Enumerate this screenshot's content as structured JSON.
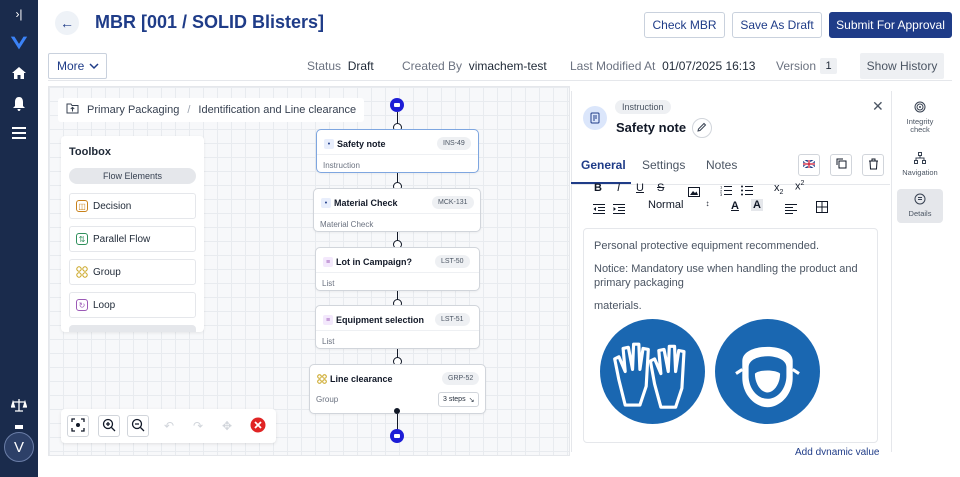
{
  "page": {
    "title": "MBR [001 / SOLID Blisters]"
  },
  "header": {
    "check_label": "Check MBR",
    "draft_label": "Save As Draft",
    "submit_label": "Submit For Approval",
    "more_label": "More",
    "status_label": "Status",
    "status_value": "Draft",
    "created_label": "Created By",
    "created_value": "vimachem-test",
    "modified_label": "Last Modified At",
    "modified_value": "01/07/2025 16:13",
    "version_label": "Version",
    "version_value": "1",
    "history_label": "Show History"
  },
  "breadcrumb": {
    "items": [
      "Primary Packaging",
      "Identification and Line clearance"
    ],
    "separator": "/"
  },
  "toolbox": {
    "title": "Toolbox",
    "section": "Flow Elements",
    "items": [
      {
        "label": "Decision",
        "icon": "decision-icon",
        "color": "#c8811a"
      },
      {
        "label": "Parallel Flow",
        "icon": "parallel-flow-icon",
        "color": "#2f8f5b"
      },
      {
        "label": "Group",
        "icon": "group-icon",
        "color": "#c8a21a"
      },
      {
        "label": "Loop",
        "icon": "loop-icon",
        "color": "#9b59b6"
      }
    ]
  },
  "flow": {
    "nodes": [
      {
        "title": "Safety note",
        "code": "INS-49",
        "subtitle": "Instruction"
      },
      {
        "title": "Material Check",
        "code": "MCK-131",
        "subtitle": "Material Check"
      },
      {
        "title": "Lot in Campaign?",
        "code": "LST-50",
        "subtitle": "List"
      },
      {
        "title": "Equipment selection",
        "code": "LST-51",
        "subtitle": "List"
      },
      {
        "title": "Line clearance",
        "code": "GRP-52",
        "subtitle": "Group",
        "steps": "3 steps"
      }
    ]
  },
  "panel": {
    "tag": "Instruction",
    "title": "Safety note",
    "tabs": [
      "General",
      "Settings",
      "Notes"
    ],
    "toolbar": {
      "style": "Normal"
    },
    "content": [
      "Personal protective equipment recommended.",
      "Notice: Mandatory use when handling the product and",
      "primary packaging",
      "materials."
    ],
    "link": "Add dynamic value"
  },
  "sidebar": {
    "items": [
      "Integrity check",
      "Navigation",
      "Details"
    ]
  },
  "colors": {
    "navy": "#1a2b4c",
    "primary": "#1f3c88",
    "terminal": "#1d1dd6",
    "safety_blue": "#1a67b1",
    "close": "#e02424"
  }
}
